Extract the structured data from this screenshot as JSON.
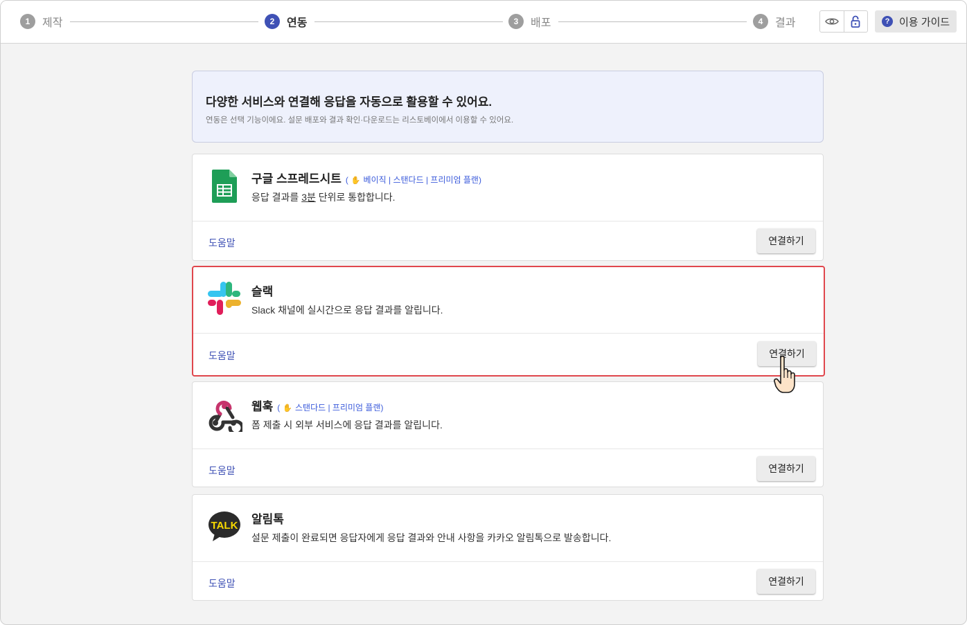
{
  "steps": [
    {
      "num": "1",
      "label": "제작"
    },
    {
      "num": "2",
      "label": "연동"
    },
    {
      "num": "3",
      "label": "배포"
    },
    {
      "num": "4",
      "label": "결과"
    }
  ],
  "header": {
    "guide_label": "이용 가이드",
    "icons": [
      "eye-icon",
      "lock-icon",
      "question-icon"
    ]
  },
  "notice": {
    "title": "다양한 서비스와 연결해 응답을 자동으로 활용할 수 있어요.",
    "subtitle": "연동은 선택 기능이에요. 설문 배포와 결과 확인·다운로드는 리스토베이에서 이용할 수 있어요."
  },
  "integrations": [
    {
      "title": "구글 스프레드시트",
      "plan": "베이직 | 스탠다드 | 프리미엄 플랜",
      "desc_pre": "응답 결과를 ",
      "desc_u": "3분",
      "desc_post": " 단위로 통합합니다.",
      "help": "도움말",
      "connect": "연결하기",
      "icon": "google-sheets-icon"
    },
    {
      "title": "슬랙",
      "plan": "",
      "desc_pre": "Slack 채널에 실시간으로 응답 결과를 알립니다.",
      "desc_u": "",
      "desc_post": "",
      "help": "도움말",
      "connect": "연결하기",
      "icon": "slack-icon"
    },
    {
      "title": "웹훅",
      "plan": "스탠다드 | 프리미엄 플랜",
      "desc_pre": "폼 제출 시 외부 서비스에 응답 결과를 알립니다.",
      "desc_u": "",
      "desc_post": "",
      "help": "도움말",
      "connect": "연결하기",
      "icon": "webhook-icon"
    },
    {
      "title": "알림톡",
      "plan": "",
      "desc_pre": "설문 제출이 완료되면 응답자에게 응답 결과와 안내 사항을 카카오 알림톡으로 발송합니다.",
      "desc_u": "",
      "desc_post": "",
      "help": "도움말",
      "connect": "연결하기",
      "icon": "kakao-talk-icon",
      "logo_text": "TALK"
    }
  ],
  "colors": {
    "accent": "#3f51b5",
    "highlight_border": "#e0464c",
    "plan_text": "#3b5bdb"
  }
}
